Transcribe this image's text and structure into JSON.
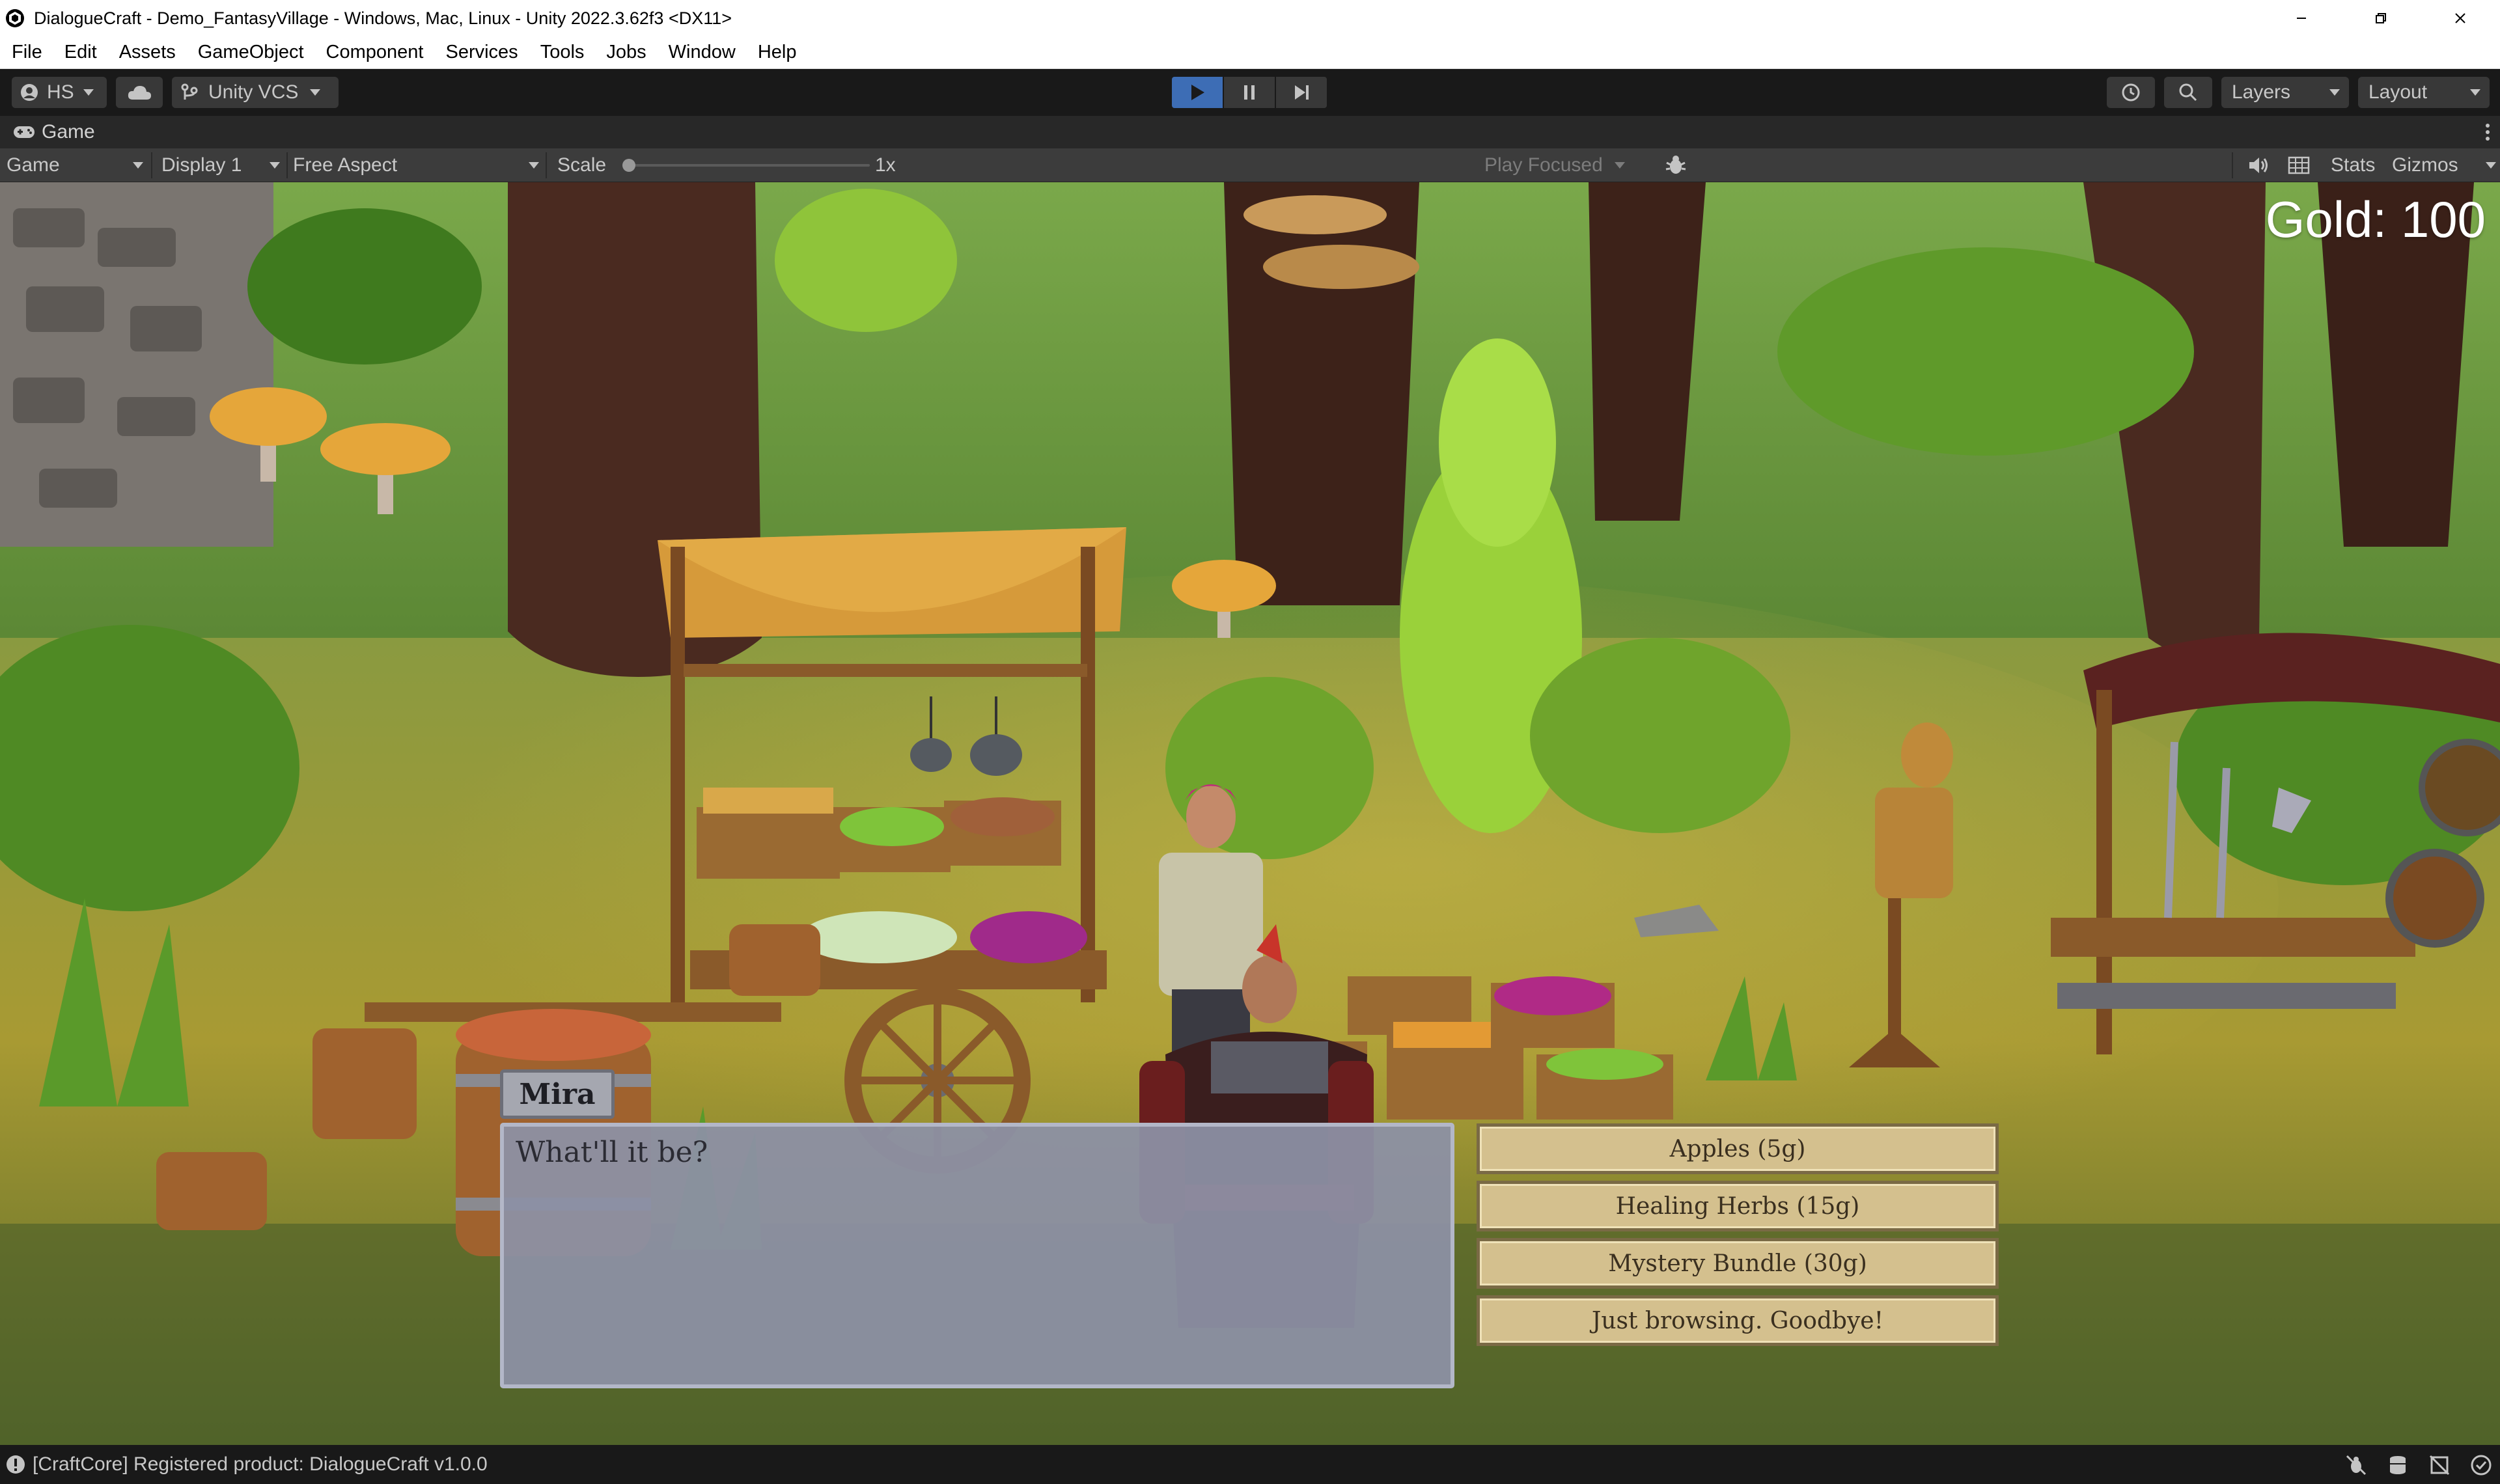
{
  "window": {
    "title": "DialogueCraft - Demo_FantasyVillage - Windows, Mac, Linux - Unity 2022.3.62f3 <DX11>",
    "app_icon": "unity-logo-icon",
    "controls": [
      "minimize-icon",
      "restore-icon",
      "close-icon"
    ]
  },
  "menu": {
    "items": [
      "File",
      "Edit",
      "Assets",
      "GameObject",
      "Component",
      "Services",
      "Tools",
      "Jobs",
      "Window",
      "Help"
    ]
  },
  "toolbar": {
    "account_label": "HS",
    "vcs_label": "Unity VCS",
    "layers_label": "Layers",
    "layout_label": "Layout",
    "play_icon": "play-icon",
    "pause_icon": "pause-icon",
    "step_icon": "step-icon"
  },
  "tab": {
    "label": "Game",
    "icon": "gamepad-icon"
  },
  "game_toolbar": {
    "view_mode": "Game",
    "display": "Display 1",
    "aspect": "Free Aspect",
    "scale_label": "Scale",
    "scale_value": "1x",
    "scale_fraction": 0.0,
    "play_mode": "Play Focused",
    "stats_label": "Stats",
    "gizmos_label": "Gizmos"
  },
  "game": {
    "gold_text": "Gold: 100",
    "dialogue": {
      "speaker": "Mira",
      "text": "What'll it be?"
    },
    "choices": [
      {
        "label": "Apples (5g)"
      },
      {
        "label": "Healing Herbs (15g)"
      },
      {
        "label": "Mystery Bundle (30g)"
      },
      {
        "label": "Just browsing. Goodbye!"
      }
    ]
  },
  "status": {
    "message": "[CraftCore] Registered product: DialogueCraft v1.0.0",
    "icon": "info-icon"
  },
  "colors": {
    "play_active": "#3d6db5",
    "choice_fill": "#d4c08e",
    "dialogue_fill": "#8c90a5"
  }
}
